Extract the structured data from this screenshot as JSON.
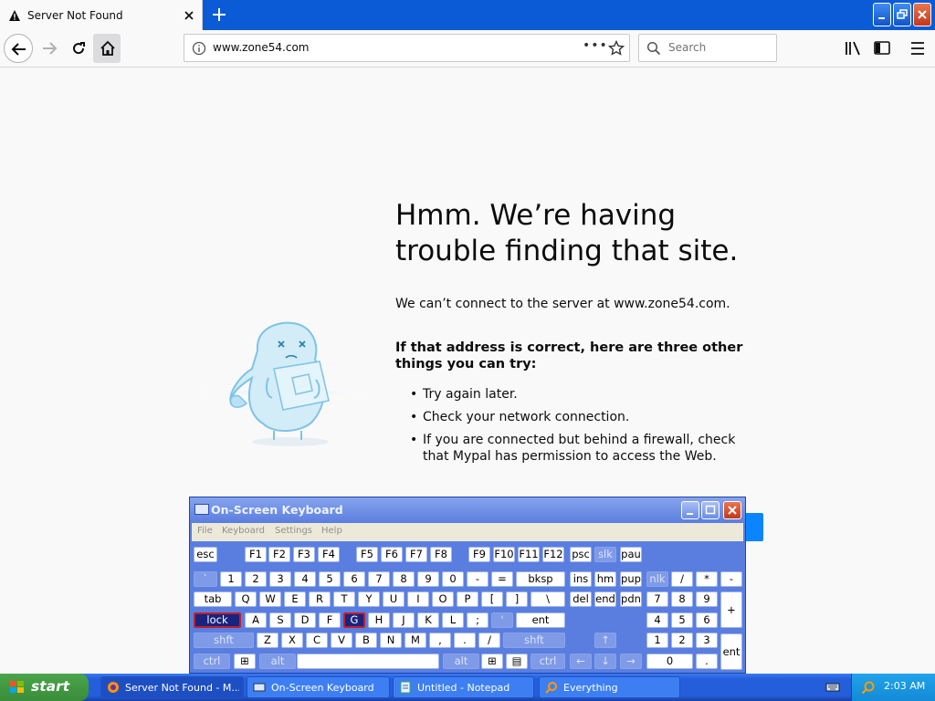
{
  "browser": {
    "tab_title": "Server Not Found",
    "url": "www.zone54.com",
    "search_placeholder": "Search",
    "page_actions_label": "•••"
  },
  "page": {
    "heading": "Hmm. We’re having trouble finding that site.",
    "description": "We can’t connect to the server at www.zone54.com.",
    "suggestions_title": "If that address is correct, here are three other things you can try:",
    "suggestions": [
      "Try again later.",
      "Check your network connection.",
      "If you are connected but behind a firewall, check that Mypal has permission to access the Web."
    ]
  },
  "osk": {
    "title": "On-Screen Keyboard",
    "menu": [
      "File",
      "Keyboard",
      "Settings",
      "Help"
    ],
    "active_keys": [
      "lock",
      "G"
    ]
  },
  "taskbar": {
    "start_label": "start",
    "tasks": [
      {
        "label": "Server Not Found - M...",
        "icon": "browser-icon",
        "active": true
      },
      {
        "label": "On-Screen Keyboard",
        "icon": "keyboard-icon",
        "active": false
      },
      {
        "label": "Untitled - Notepad",
        "icon": "notepad-icon",
        "active": false
      },
      {
        "label": "Everything",
        "icon": "search-icon",
        "active": false
      }
    ],
    "clock": "2:03 AM"
  },
  "colors": {
    "titlebar": "#0b5bd6",
    "accent_button": "#0a84ff",
    "taskbar": "#245edb",
    "start_button": "#3a8d3a"
  }
}
